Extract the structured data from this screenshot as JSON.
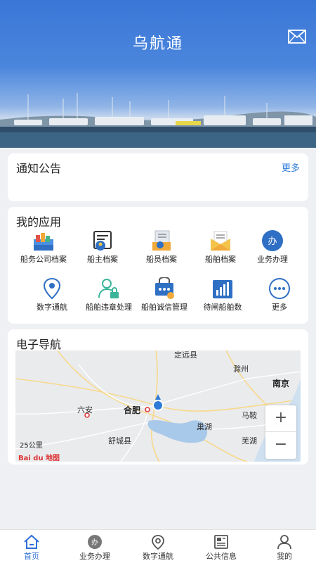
{
  "header": {
    "title": "乌航通",
    "mail_icon": "mail-icon"
  },
  "notice": {
    "title": "通知公告",
    "more": "更多"
  },
  "apps": {
    "title": "我的应用",
    "items": [
      {
        "label": "船务公司档案",
        "icon": "company-file-icon"
      },
      {
        "label": "船主档案",
        "icon": "owner-file-icon"
      },
      {
        "label": "船员档案",
        "icon": "crew-file-icon"
      },
      {
        "label": "船舶档案",
        "icon": "ship-file-icon"
      },
      {
        "label": "业务办理",
        "icon": "business-icon"
      },
      {
        "label": "数字通航",
        "icon": "location-icon"
      },
      {
        "label": "船舶违章处理",
        "icon": "violation-icon"
      },
      {
        "label": "船舶诚信管理",
        "icon": "credit-icon"
      },
      {
        "label": "待闸船舶数",
        "icon": "chart-icon"
      },
      {
        "label": "更多",
        "icon": "more-icon"
      }
    ],
    "business_glyph": "办"
  },
  "navigation": {
    "title": "电子导航",
    "places": [
      "定远县",
      "滁州",
      "南京",
      "六安",
      "合肥",
      "马鞍",
      "巢湖",
      "舒城县",
      "芜湖"
    ],
    "scale": "25公里",
    "logo": "Bai du 地图",
    "zoom_in": "+",
    "zoom_out": "−"
  },
  "tabbar": {
    "items": [
      {
        "label": "首页",
        "icon": "home-icon",
        "active": true
      },
      {
        "label": "业务办理",
        "icon": "business-icon"
      },
      {
        "label": "数字通航",
        "icon": "location-icon"
      },
      {
        "label": "公共信息",
        "icon": "news-icon"
      },
      {
        "label": "我的",
        "icon": "user-icon"
      }
    ],
    "business_glyph": "办"
  },
  "colors": {
    "accent": "#2f7bd8",
    "header_blue": "#3a76d6",
    "active_tab": "#2f6fd6"
  }
}
